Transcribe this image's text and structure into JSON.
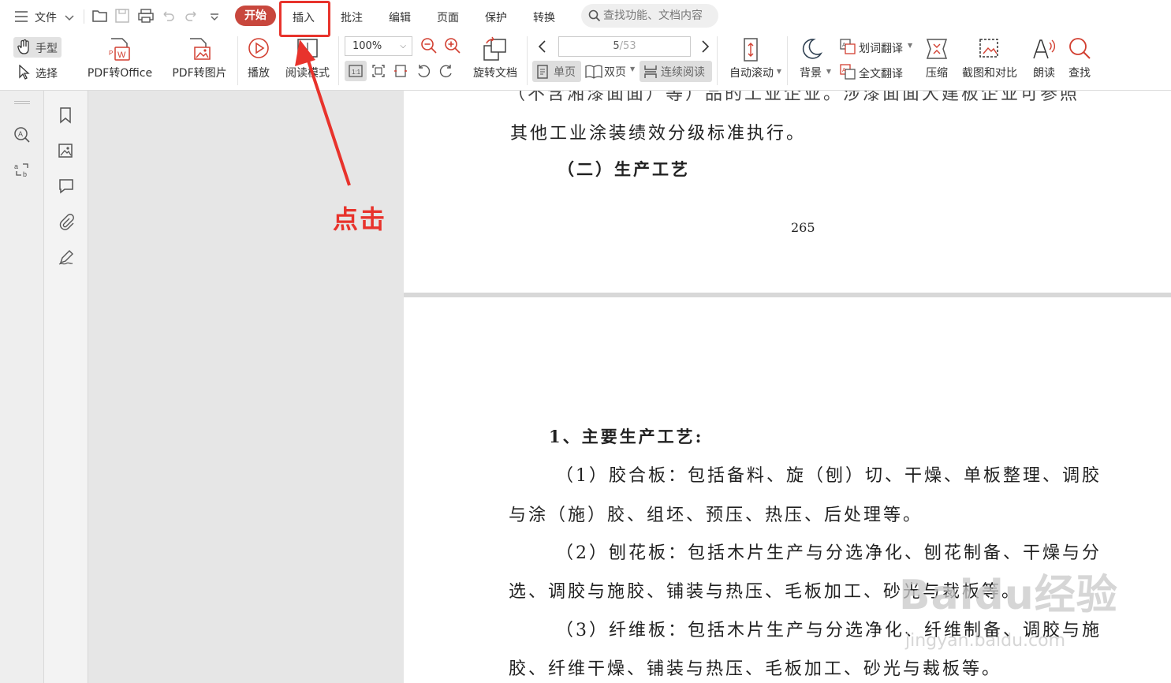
{
  "menubar": {
    "file": "文件",
    "tabs": [
      "开始",
      "插入",
      "批注",
      "编辑",
      "页面",
      "保护",
      "转换"
    ],
    "search_placeholder": "查找功能、文档内容"
  },
  "ribbon": {
    "hand_tool": "手型",
    "select_tool": "选择",
    "pdf_to_office": "PDF转Office",
    "pdf_to_image": "PDF转图片",
    "play": "播放",
    "read_mode": "阅读模式",
    "zoom_value": "100%",
    "rotate_doc": "旋转文档",
    "page_current": "5",
    "page_total": "/53",
    "single_page": "单页",
    "double_page": "双页",
    "continuous_read": "连续阅读",
    "auto_scroll": "自动滚动",
    "background": "背景",
    "word_translate": "划词翻译",
    "full_translate": "全文翻译",
    "compress": "压缩",
    "screenshot_compare": "截图和对比",
    "read_aloud": "朗读",
    "find": "查找"
  },
  "document": {
    "page1": {
      "line_cut": "（不含湘漆面面）等）品的工业企业。涉漆面面大建板企业可参照",
      "line1": "其他工业涂装绩效分级标准执行。",
      "heading": "（二）生产工艺",
      "page_number": "265"
    },
    "page2": {
      "heading": "1、主要生产工艺:",
      "p1a": "（1）胶合板：包括备料、旋（刨）切、干燥、单板整理、调胶",
      "p1b": "与涂（施）胶、组坯、预压、热压、后处理等。",
      "p2a": "（2）刨花板：包括木片生产与分选净化、刨花制备、干燥与分",
      "p2b": "选、调胶与施胶、铺装与热压、毛板加工、砂光与裁板等。",
      "p3a": "（3）纤维板：包括木片生产与分选净化、纤维制备、调胶与施",
      "p3b": "胶、纤维干燥、铺装与热压、毛板加工、砂光与裁板等。"
    }
  },
  "annotation": {
    "label": "点击",
    "color": "#e8332c"
  },
  "watermark": {
    "brand": "Baidu经验",
    "url": "jingyan.baidu.com"
  },
  "colors": {
    "accent": "#c8473d",
    "annotation": "#e8332c"
  }
}
